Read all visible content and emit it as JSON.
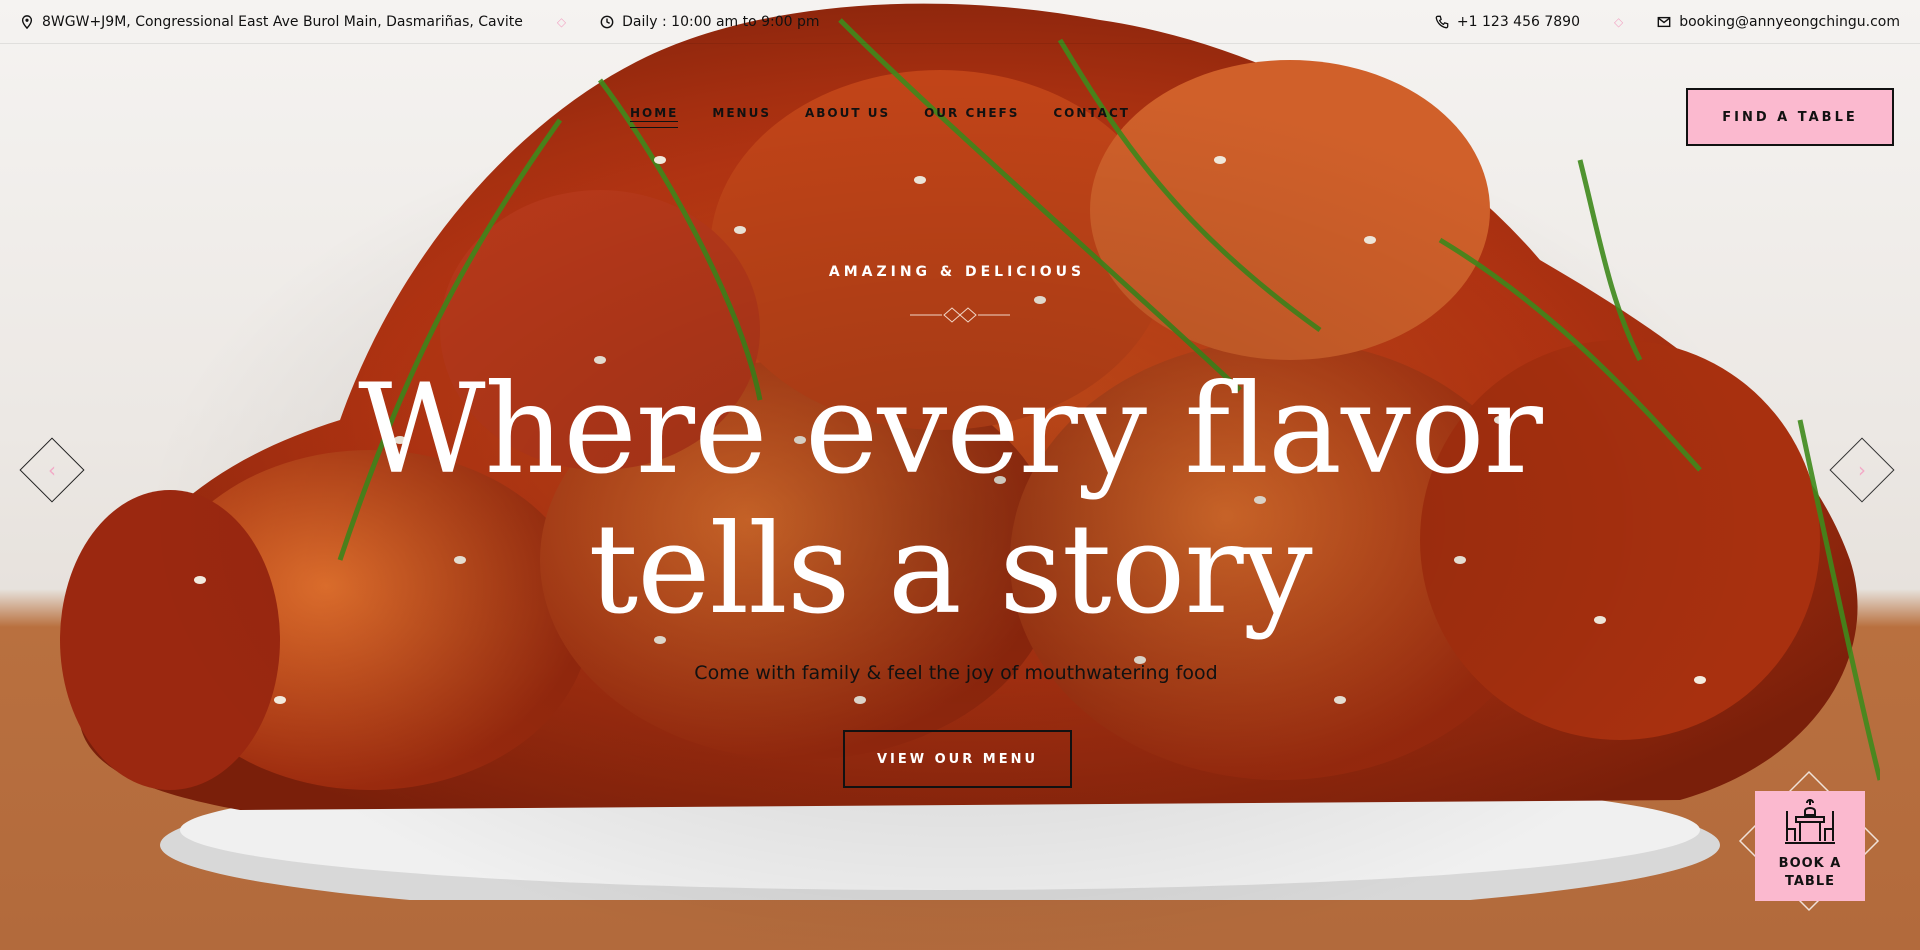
{
  "topbar": {
    "address": "8WGW+J9M, Congressional East Ave Burol Main, Dasmariñas, Cavite",
    "hours": "Daily : 10:00 am to 9:00 pm",
    "phone": "+1 123 456 7890",
    "email": "booking@annyeongchingu.com"
  },
  "nav": {
    "items": [
      "HOME",
      "MENUS",
      "ABOUT US",
      "OUR CHEFS",
      "CONTACT"
    ],
    "cta": "FIND A TABLE"
  },
  "hero": {
    "eyebrow": "AMAZING & DELICIOUS",
    "headline_line1": "Where every flavor",
    "headline_line2": "tells a story",
    "subline": "Come with family & feel the joy of mouthwatering food",
    "button": "VIEW OUR MENU"
  },
  "book_widget": {
    "line1": "BOOK A",
    "line2": "TABLE"
  },
  "colors": {
    "accent_pink": "#fbb9cf",
    "text_dark": "#111111"
  },
  "icons": [
    "location-pin-icon",
    "clock-icon",
    "phone-icon",
    "mail-icon",
    "chevron-left-icon",
    "chevron-right-icon",
    "dining-table-icon"
  ]
}
